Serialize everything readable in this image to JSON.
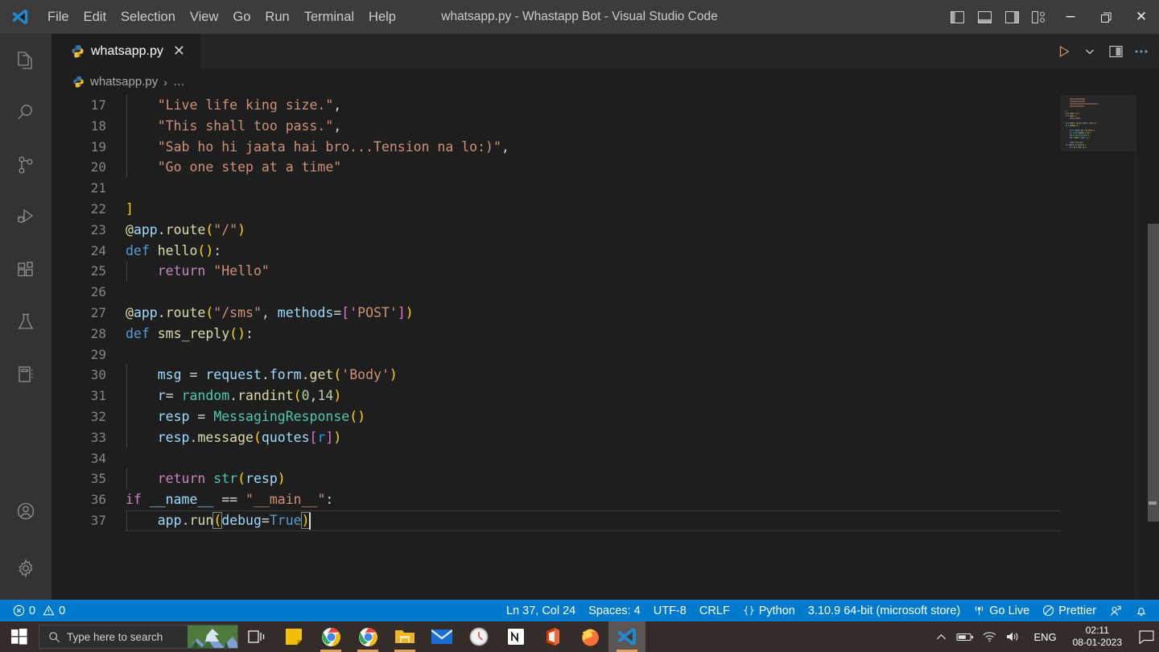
{
  "window": {
    "title": "whatsapp.py - Whastapp Bot - Visual Studio Code",
    "minimize_label": "−",
    "maximize_label": "❐",
    "close_label": "✕"
  },
  "menubar": {
    "items": [
      {
        "label": "File"
      },
      {
        "label": "Edit"
      },
      {
        "label": "Selection"
      },
      {
        "label": "View"
      },
      {
        "label": "Go"
      },
      {
        "label": "Run"
      },
      {
        "label": "Terminal"
      },
      {
        "label": "Help"
      }
    ]
  },
  "activitybar": {
    "items": [
      {
        "name": "explorer",
        "title": "Explorer"
      },
      {
        "name": "search",
        "title": "Search"
      },
      {
        "name": "source-control",
        "title": "Source Control"
      },
      {
        "name": "run-and-debug",
        "title": "Run and Debug"
      },
      {
        "name": "extensions",
        "title": "Extensions"
      },
      {
        "name": "testing",
        "title": "Testing"
      },
      {
        "name": "notebook",
        "title": "Notebook"
      }
    ],
    "bottom": [
      {
        "name": "accounts",
        "title": "Accounts"
      },
      {
        "name": "settings",
        "title": "Manage"
      }
    ]
  },
  "tabs": [
    {
      "label": "whatsapp.py",
      "icon": "python-icon",
      "close": "✕",
      "active": true
    }
  ],
  "editor_actions": [
    {
      "name": "run-python-file",
      "icon": "play-icon"
    },
    {
      "name": "run-dropdown",
      "icon": "chevron-down-icon"
    },
    {
      "name": "split-editor",
      "icon": "split-editor-icon"
    },
    {
      "name": "more-actions",
      "icon": "ellipsis-icon"
    }
  ],
  "breadcrumb": {
    "file": "whatsapp.py",
    "separator": "›",
    "rest": "…"
  },
  "code": {
    "first_line": 17,
    "lines": [
      {
        "n": 17,
        "indent": 1,
        "tokens": [
          {
            "t": "\"Live life king size.\"",
            "c": "t-str"
          },
          {
            "t": ",",
            "c": "t-plain"
          }
        ]
      },
      {
        "n": 18,
        "indent": 1,
        "tokens": [
          {
            "t": "\"This shall too pass.\"",
            "c": "t-str"
          },
          {
            "t": ",",
            "c": "t-plain"
          }
        ]
      },
      {
        "n": 19,
        "indent": 1,
        "tokens": [
          {
            "t": "\"Sab ho hi jaata hai bro...Tension na lo:)\"",
            "c": "t-str"
          },
          {
            "t": ",",
            "c": "t-plain"
          }
        ]
      },
      {
        "n": 20,
        "indent": 1,
        "tokens": [
          {
            "t": "\"Go one step at a time\"",
            "c": "t-str"
          }
        ]
      },
      {
        "n": 21,
        "indent": 0,
        "tokens": []
      },
      {
        "n": 22,
        "indent": 0,
        "tokens": [
          {
            "t": "]",
            "c": "t-p1"
          }
        ]
      },
      {
        "n": 23,
        "indent": 0,
        "tokens": [
          {
            "t": "@",
            "c": "t-fn"
          },
          {
            "t": "app",
            "c": "t-var"
          },
          {
            "t": ".",
            "c": "t-plain"
          },
          {
            "t": "route",
            "c": "t-fn"
          },
          {
            "t": "(",
            "c": "t-p1"
          },
          {
            "t": "\"/\"",
            "c": "t-str"
          },
          {
            "t": ")",
            "c": "t-p1"
          }
        ]
      },
      {
        "n": 24,
        "indent": 0,
        "tokens": [
          {
            "t": "def",
            "c": "t-kw"
          },
          {
            "t": " ",
            "c": "t-plain"
          },
          {
            "t": "hello",
            "c": "t-fn"
          },
          {
            "t": "(",
            "c": "t-p1"
          },
          {
            "t": ")",
            "c": "t-p1"
          },
          {
            "t": ":",
            "c": "t-plain"
          }
        ]
      },
      {
        "n": 25,
        "indent": 1,
        "tokens": [
          {
            "t": "return",
            "c": "t-kw2"
          },
          {
            "t": " ",
            "c": "t-plain"
          },
          {
            "t": "\"Hello\"",
            "c": "t-str"
          }
        ]
      },
      {
        "n": 26,
        "indent": 0,
        "tokens": []
      },
      {
        "n": 27,
        "indent": 0,
        "tokens": [
          {
            "t": "@",
            "c": "t-fn"
          },
          {
            "t": "app",
            "c": "t-var"
          },
          {
            "t": ".",
            "c": "t-plain"
          },
          {
            "t": "route",
            "c": "t-fn"
          },
          {
            "t": "(",
            "c": "t-p1"
          },
          {
            "t": "\"/sms\"",
            "c": "t-str"
          },
          {
            "t": ", ",
            "c": "t-plain"
          },
          {
            "t": "methods",
            "c": "t-var"
          },
          {
            "t": "=",
            "c": "t-plain"
          },
          {
            "t": "[",
            "c": "t-p2"
          },
          {
            "t": "'POST'",
            "c": "t-str"
          },
          {
            "t": "]",
            "c": "t-p2"
          },
          {
            "t": ")",
            "c": "t-p1"
          }
        ]
      },
      {
        "n": 28,
        "indent": 0,
        "tokens": [
          {
            "t": "def",
            "c": "t-kw"
          },
          {
            "t": " ",
            "c": "t-plain"
          },
          {
            "t": "sms_reply",
            "c": "t-fn"
          },
          {
            "t": "(",
            "c": "t-p1"
          },
          {
            "t": ")",
            "c": "t-p1"
          },
          {
            "t": ":",
            "c": "t-plain"
          }
        ]
      },
      {
        "n": 29,
        "indent": 0,
        "tokens": []
      },
      {
        "n": 30,
        "indent": 1,
        "tokens": [
          {
            "t": "msg",
            "c": "t-var"
          },
          {
            "t": " = ",
            "c": "t-plain"
          },
          {
            "t": "request",
            "c": "t-var"
          },
          {
            "t": ".",
            "c": "t-plain"
          },
          {
            "t": "form",
            "c": "t-var"
          },
          {
            "t": ".",
            "c": "t-plain"
          },
          {
            "t": "get",
            "c": "t-fn"
          },
          {
            "t": "(",
            "c": "t-p1"
          },
          {
            "t": "'Body'",
            "c": "t-str"
          },
          {
            "t": ")",
            "c": "t-p1"
          }
        ]
      },
      {
        "n": 31,
        "indent": 1,
        "tokens": [
          {
            "t": "r",
            "c": "t-var"
          },
          {
            "t": "= ",
            "c": "t-plain"
          },
          {
            "t": "random",
            "c": "t-cls"
          },
          {
            "t": ".",
            "c": "t-plain"
          },
          {
            "t": "randint",
            "c": "t-fn"
          },
          {
            "t": "(",
            "c": "t-p1"
          },
          {
            "t": "0",
            "c": "t-num"
          },
          {
            "t": ",",
            "c": "t-plain"
          },
          {
            "t": "14",
            "c": "t-num"
          },
          {
            "t": ")",
            "c": "t-p1"
          }
        ]
      },
      {
        "n": 32,
        "indent": 1,
        "tokens": [
          {
            "t": "resp",
            "c": "t-var"
          },
          {
            "t": " = ",
            "c": "t-plain"
          },
          {
            "t": "MessagingResponse",
            "c": "t-cls"
          },
          {
            "t": "(",
            "c": "t-p1"
          },
          {
            "t": ")",
            "c": "t-p1"
          }
        ]
      },
      {
        "n": 33,
        "indent": 1,
        "tokens": [
          {
            "t": "resp",
            "c": "t-var"
          },
          {
            "t": ".",
            "c": "t-plain"
          },
          {
            "t": "message",
            "c": "t-fn"
          },
          {
            "t": "(",
            "c": "t-p1"
          },
          {
            "t": "quotes",
            "c": "t-var"
          },
          {
            "t": "[",
            "c": "t-p2"
          },
          {
            "t": "r",
            "c": "t-p3"
          },
          {
            "t": "]",
            "c": "t-p2"
          },
          {
            "t": ")",
            "c": "t-p1"
          }
        ]
      },
      {
        "n": 34,
        "indent": 0,
        "tokens": []
      },
      {
        "n": 35,
        "indent": 1,
        "tokens": [
          {
            "t": "return",
            "c": "t-kw2"
          },
          {
            "t": " ",
            "c": "t-plain"
          },
          {
            "t": "str",
            "c": "t-cls"
          },
          {
            "t": "(",
            "c": "t-p1"
          },
          {
            "t": "resp",
            "c": "t-var"
          },
          {
            "t": ")",
            "c": "t-p1"
          }
        ]
      },
      {
        "n": 36,
        "indent": 0,
        "tokens": [
          {
            "t": "if",
            "c": "t-kw2"
          },
          {
            "t": " ",
            "c": "t-plain"
          },
          {
            "t": "__name__",
            "c": "t-var"
          },
          {
            "t": " == ",
            "c": "t-plain"
          },
          {
            "t": "\"__main__\"",
            "c": "t-str"
          },
          {
            "t": ":",
            "c": "t-plain"
          }
        ]
      },
      {
        "n": 37,
        "indent": 1,
        "current": true,
        "tokens": [
          {
            "t": "app",
            "c": "t-var"
          },
          {
            "t": ".",
            "c": "t-plain"
          },
          {
            "t": "run",
            "c": "t-fn"
          },
          {
            "t": "(",
            "c": "t-p1",
            "box": true
          },
          {
            "t": "debug",
            "c": "t-var"
          },
          {
            "t": "=",
            "c": "t-plain"
          },
          {
            "t": "True",
            "c": "t-kw"
          },
          {
            "t": ")",
            "c": "t-p1",
            "box": true
          }
        ]
      }
    ]
  },
  "statusbar": {
    "left": [
      {
        "name": "problems",
        "icon": "error-icon",
        "label": "0",
        "icon2": "warning-icon",
        "label2": "0"
      }
    ],
    "errors": "0",
    "warnings": "0",
    "right": [
      {
        "name": "cursor-position",
        "label": "Ln 37, Col 24"
      },
      {
        "name": "indentation",
        "label": "Spaces: 4"
      },
      {
        "name": "encoding",
        "label": "UTF-8"
      },
      {
        "name": "eol",
        "label": "CRLF"
      },
      {
        "name": "language-mode",
        "label": "Python",
        "icon": "braces-icon"
      },
      {
        "name": "python-interpreter",
        "label": "3.10.9 64-bit (microsoft store)"
      },
      {
        "name": "go-live",
        "label": "Go Live",
        "icon": "broadcast-icon"
      },
      {
        "name": "prettier",
        "label": "Prettier",
        "icon": "prettier-icon"
      },
      {
        "name": "live-share",
        "label": "",
        "icon": "live-share-icon"
      },
      {
        "name": "notifications",
        "label": "",
        "icon": "bell-icon"
      }
    ]
  },
  "taskbar": {
    "start": "windows-start-icon",
    "search_placeholder": "Type here to search",
    "items": [
      {
        "name": "task-view",
        "icon": "task-view-icon"
      },
      {
        "name": "sticky-notes",
        "icon": "sticky-notes-icon"
      },
      {
        "name": "chrome-1",
        "icon": "chrome-icon"
      },
      {
        "name": "chrome-2",
        "icon": "chrome-icon"
      },
      {
        "name": "file-explorer",
        "icon": "folder-icon"
      },
      {
        "name": "mail",
        "icon": "mail-icon"
      },
      {
        "name": "clock",
        "icon": "clock-icon"
      },
      {
        "name": "notion",
        "icon": "notion-icon"
      },
      {
        "name": "office",
        "icon": "office-icon"
      },
      {
        "name": "firefox",
        "icon": "firefox-icon"
      },
      {
        "name": "visual-studio-code",
        "icon": "vscode-icon"
      }
    ],
    "tray": {
      "show_hidden": "chevron-up-icon",
      "battery": "battery-icon",
      "network": "wifi-icon",
      "volume": "speaker-icon",
      "language": "ENG",
      "time": "02:11",
      "date": "08-01-2023",
      "action_center": "action-center-icon"
    }
  },
  "colors": {
    "accent": "#007acc",
    "titlebar": "#3c3c3c",
    "activitybar": "#333333",
    "editor_bg": "#1e1e1e",
    "tabbar_bg": "#252526",
    "taskbar": "#332c28",
    "orange_strip": "#d1622b"
  }
}
